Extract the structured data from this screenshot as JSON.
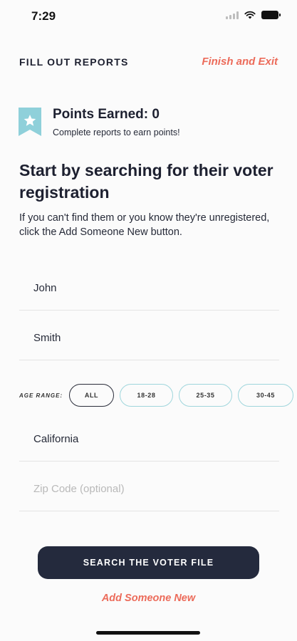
{
  "status_bar": {
    "time": "7:29"
  },
  "header": {
    "title": "FILL OUT REPORTS",
    "exit_label": "Finish and Exit"
  },
  "points": {
    "title": "Points Earned: 0",
    "subtitle": "Complete reports to earn points!"
  },
  "main": {
    "heading": "Start by searching for their voter registration",
    "description": "If you can't find them or you know they're unregistered, click the Add Someone New button."
  },
  "form": {
    "first_name": {
      "value": "John"
    },
    "last_name": {
      "value": "Smith"
    },
    "age_range": {
      "label": "AGE RANGE:",
      "options": [
        "ALL",
        "18-28",
        "25-35",
        "30-45"
      ],
      "selected": "ALL"
    },
    "state": {
      "value": "California"
    },
    "zip": {
      "value": "",
      "placeholder": "Zip Code (optional)"
    }
  },
  "actions": {
    "search_label": "SEARCH THE VOTER FILE",
    "add_label": "Add Someone New"
  },
  "colors": {
    "accent": "#ec6b5a",
    "primary": "#242a3d",
    "teal": "#9fd6dc",
    "badge": "#8fd0da"
  },
  "icons": {
    "badge": "star-ribbon-icon",
    "wifi": "wifi-icon",
    "signal": "signal-icon",
    "battery": "battery-icon"
  }
}
